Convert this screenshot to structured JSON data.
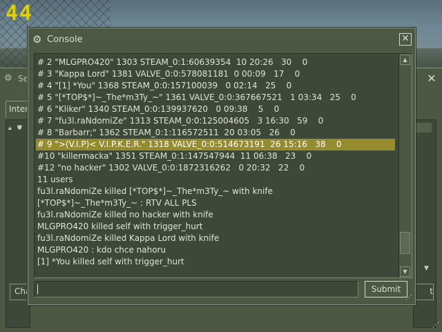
{
  "hud": {
    "counter": "44"
  },
  "background_window": {
    "title": "Se",
    "tab_label": "Inter",
    "chat_button": "Cha",
    "right_button": "t"
  },
  "console": {
    "title": "Console",
    "lines": [
      "# 2 \"MLGPRO420\" 1303 STEAM_0:1:60639354  10 20:26   30    0",
      "# 3 \"Kappa Lord\" 1381 VALVE_0:0:578081181  0 00:09   17    0",
      "# 4 \"[1] *You\" 1368 STEAM_0:0:157100039   0 02:14   25    0",
      "# 5 \"[*TOP$*]~_The*m3Ty_~\" 1361 VALVE_0:0:367667521   1 03:34   25    0",
      "# 6 \"Kliker\" 1340 STEAM_0:0:139937620   0 09:38    5    0",
      "# 7 \"fu3l.raNdomiZe\" 1313 STEAM_0:0:125004605   3 16:30   59    0",
      "# 8 \"Barbarr;\" 1362 STEAM_0:1:116572511  20 03:05   26    0",
      "# 9 \">(V.I.P)< V.I.P.K.E.R.\" 1318 VALVE_0:0:514673191  26 15:16   38    0",
      "#10 \"killermacka\" 1351 STEAM_0:1:147547944  11 06:38   23    0",
      "#12 \"no hacker\" 1302 VALVE_0:0:1872316262   0 20:32   22    0",
      "11 users",
      "fu3l.raNdomiZe killed [*TOP$*]~_The*m3Ty_~ with knife",
      "[*TOP$*]~_The*m3Ty_~ : RTV ALL PLS",
      "fu3l.raNdomiZe killed no hacker with knife",
      "MLGPRO420 killed self with trigger_hurt",
      "fu3l.raNdomiZe killed Kappa Lord with knife",
      "MLGPRO420 : kdo chce nahoru",
      "[1] *You killed self with trigger_hurt"
    ],
    "highlighted_line_index": 7,
    "input_value": "",
    "submit_label": "Submit"
  }
}
